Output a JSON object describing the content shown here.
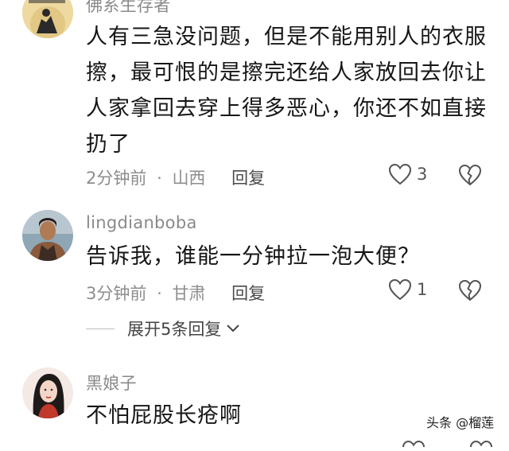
{
  "comments": [
    {
      "username": "佛系生存者",
      "text": "人有三急没问题，但是不能用别人的衣服擦，最可恨的是擦完还给人家放回去你让人家拿回去穿上得多恶心，你还不如直接扔了",
      "time": "2分钟前",
      "location": "山西",
      "likes": "3"
    },
    {
      "username": "lingdianboba",
      "text": "告诉我，谁能一分钟拉一泡大便？",
      "time": "3分钟前",
      "location": "甘肃",
      "likes": "1"
    },
    {
      "username": "黑娘子",
      "text": "不怕屁股长疮啊"
    }
  ],
  "labels": {
    "reply": "回复",
    "separator": "·",
    "expand_replies": "展开5条回复"
  },
  "watermark": "头条 @榴莲",
  "colors": {
    "username": "#8a8a8a",
    "content": "#161616",
    "meta": "#8d8d8d"
  },
  "icons": {
    "like": "heart-outline-icon",
    "dislike": "broken-heart-icon",
    "expand": "chevron-down-icon"
  }
}
